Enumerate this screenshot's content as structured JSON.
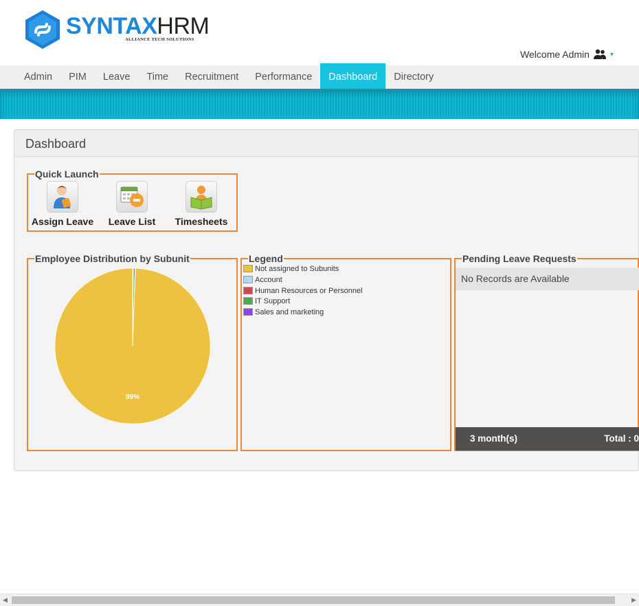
{
  "brand": {
    "name_part1": "SYNTAX",
    "name_part2": "HRM",
    "tagline": "ALLIANCE TECH SOLUTIONS"
  },
  "header": {
    "welcome": "Welcome Admin",
    "user_icon": "users-icon",
    "caret": "▾"
  },
  "menu": {
    "items": [
      {
        "label": "Admin"
      },
      {
        "label": "PIM"
      },
      {
        "label": "Leave"
      },
      {
        "label": "Time"
      },
      {
        "label": "Recruitment"
      },
      {
        "label": "Performance"
      },
      {
        "label": "Dashboard",
        "active": true
      },
      {
        "label": "Directory"
      }
    ],
    "active_color": "#18c3e0"
  },
  "dashboard": {
    "title": "Dashboard",
    "quick_launch": {
      "legend": "Quick Launch",
      "items": [
        {
          "label": "Assign Leave",
          "icon": "assign-leave-icon"
        },
        {
          "label": "Leave List",
          "icon": "leave-list-icon"
        },
        {
          "label": "Timesheets",
          "icon": "timesheets-icon"
        }
      ]
    },
    "distribution": {
      "legend": "Employee Distribution by Subunit"
    },
    "legend_panel": {
      "legend": "Legend",
      "items": [
        {
          "label": "Not assigned to Subunits",
          "color": "#edc240"
        },
        {
          "label": "Account",
          "color": "#afd8f8"
        },
        {
          "label": "Human Resources or Personnel",
          "color": "#cb4b4b"
        },
        {
          "label": "IT Support",
          "color": "#4da74d"
        },
        {
          "label": "Sales and marketing",
          "color": "#9440ed"
        }
      ]
    },
    "pending": {
      "legend": "Pending Leave Requests",
      "empty_text": "No Records are Available",
      "period": "3 month(s)",
      "total": "Total : 0"
    }
  },
  "chart_data": {
    "type": "pie",
    "categories": [
      "Not assigned to Subunits",
      "Account",
      "Human Resources or Personnel",
      "IT Support",
      "Sales and marketing"
    ],
    "values": [
      99.4,
      0.1,
      0.1,
      0.3,
      0.1
    ],
    "colors": [
      "#edc240",
      "#afd8f8",
      "#cb4b4b",
      "#4da74d",
      "#9440ed"
    ],
    "data_labels": [
      "99%"
    ]
  }
}
